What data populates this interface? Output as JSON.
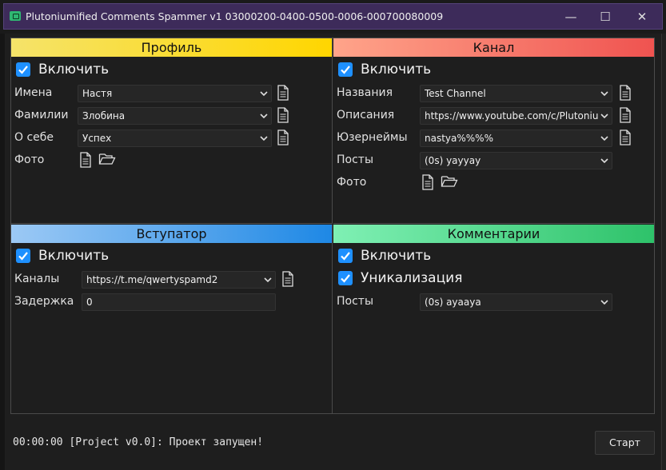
{
  "window": {
    "title": "Plutoniumified Comments Spammer v1 03000200-0400-0500-0006-000700080009",
    "minimize": "—",
    "maximize": "☐",
    "close": "✕"
  },
  "profile": {
    "header": "Профиль",
    "enable": {
      "label": "Включить",
      "checked": true
    },
    "names": {
      "label": "Имена",
      "value": "Настя"
    },
    "surnames": {
      "label": "Фамилии",
      "value": "Злобина"
    },
    "about": {
      "label": "О себе",
      "value": "Успех"
    },
    "photo": {
      "label": "Фото"
    }
  },
  "channel": {
    "header": "Канал",
    "enable": {
      "label": "Включить",
      "checked": true
    },
    "titles": {
      "label": "Названия",
      "value": "Test Channel"
    },
    "descriptions": {
      "label": "Описания",
      "value": "https://www.youtube.com/c/Plutonium"
    },
    "usernames": {
      "label": "Юзернеймы",
      "value": "nastya%%%%"
    },
    "posts": {
      "label": "Посты",
      "value": "(0s) yayyay"
    },
    "photo": {
      "label": "Фото"
    }
  },
  "joiner": {
    "header": "Вступатор",
    "enable": {
      "label": "Включить",
      "checked": true
    },
    "channels": {
      "label": "Каналы",
      "value": "https://t.me/qwertyspamd2"
    },
    "delay": {
      "label": "Задержка",
      "value": "0"
    }
  },
  "comments": {
    "header": "Комментарии",
    "enable": {
      "label": "Включить",
      "checked": true
    },
    "uniqueize": {
      "label": "Уникализация",
      "checked": true
    },
    "posts": {
      "label": "Посты",
      "value": "(0s) ayaaya"
    }
  },
  "console": {
    "log": "00:00:00 [Project v0.0]: Проект запущен!",
    "start_label": "Старт"
  },
  "colors": {
    "titlebar": "#3d2b5a",
    "checkbox": "#1e90ff",
    "profile_header": "#ffd600",
    "channel_header": "#ef5350",
    "joiner_header": "#1e88e5",
    "comments_header": "#2ec26a"
  }
}
